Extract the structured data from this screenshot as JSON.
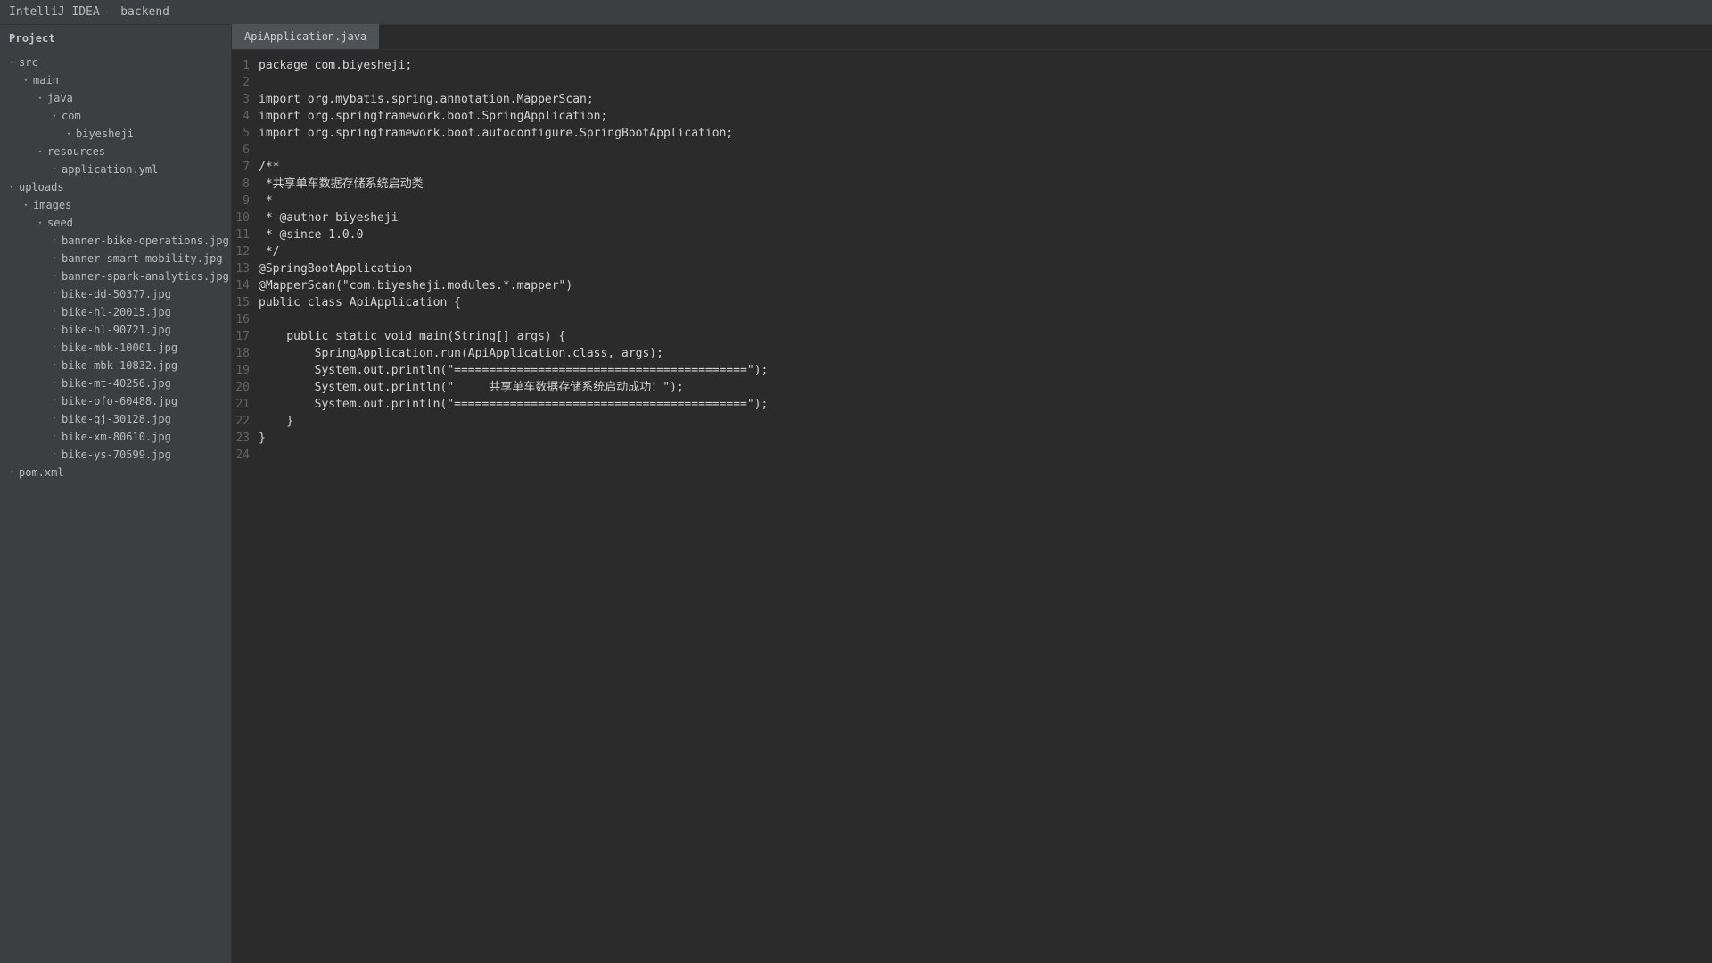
{
  "window": {
    "title": "IntelliJ IDEA — backend"
  },
  "sidebar": {
    "header": "Project",
    "items": [
      {
        "label": "src",
        "depth": 0,
        "type": "folder",
        "expanded": true
      },
      {
        "label": "main",
        "depth": 1,
        "type": "folder",
        "expanded": true
      },
      {
        "label": "java",
        "depth": 2,
        "type": "folder",
        "expanded": true
      },
      {
        "label": "com",
        "depth": 3,
        "type": "folder",
        "expanded": true
      },
      {
        "label": "biyesheji",
        "depth": 4,
        "type": "folder",
        "expanded": true
      },
      {
        "label": "resources",
        "depth": 2,
        "type": "folder",
        "expanded": true
      },
      {
        "label": "application.yml",
        "depth": 3,
        "type": "file"
      },
      {
        "label": "uploads",
        "depth": 0,
        "type": "folder",
        "expanded": true
      },
      {
        "label": "images",
        "depth": 1,
        "type": "folder",
        "expanded": true
      },
      {
        "label": "seed",
        "depth": 2,
        "type": "folder",
        "expanded": true
      },
      {
        "label": "banner-bike-operations.jpg",
        "depth": 3,
        "type": "file"
      },
      {
        "label": "banner-smart-mobility.jpg",
        "depth": 3,
        "type": "file"
      },
      {
        "label": "banner-spark-analytics.jpg",
        "depth": 3,
        "type": "file"
      },
      {
        "label": "bike-dd-50377.jpg",
        "depth": 3,
        "type": "file"
      },
      {
        "label": "bike-hl-20015.jpg",
        "depth": 3,
        "type": "file"
      },
      {
        "label": "bike-hl-90721.jpg",
        "depth": 3,
        "type": "file"
      },
      {
        "label": "bike-mbk-10001.jpg",
        "depth": 3,
        "type": "file"
      },
      {
        "label": "bike-mbk-10832.jpg",
        "depth": 3,
        "type": "file"
      },
      {
        "label": "bike-mt-40256.jpg",
        "depth": 3,
        "type": "file"
      },
      {
        "label": "bike-ofo-60488.jpg",
        "depth": 3,
        "type": "file"
      },
      {
        "label": "bike-qj-30128.jpg",
        "depth": 3,
        "type": "file"
      },
      {
        "label": "bike-xm-80610.jpg",
        "depth": 3,
        "type": "file"
      },
      {
        "label": "bike-ys-70599.jpg",
        "depth": 3,
        "type": "file"
      },
      {
        "label": "pom.xml",
        "depth": 0,
        "type": "file"
      }
    ]
  },
  "editor": {
    "tabs": [
      {
        "label": "ApiApplication.java",
        "active": true
      }
    ],
    "lines": [
      {
        "no": "1",
        "text": "package com.biyesheji;"
      },
      {
        "no": "2",
        "text": ""
      },
      {
        "no": "3",
        "text": "import org.mybatis.spring.annotation.MapperScan;"
      },
      {
        "no": "4",
        "text": "import org.springframework.boot.SpringApplication;"
      },
      {
        "no": "5",
        "text": "import org.springframework.boot.autoconfigure.SpringBootApplication;"
      },
      {
        "no": "6",
        "text": ""
      },
      {
        "no": "7",
        "text": "/**"
      },
      {
        "no": "8",
        "text": " *共享单车数据存储系统启动类"
      },
      {
        "no": "9",
        "text": " *"
      },
      {
        "no": "10",
        "text": " * @author biyesheji"
      },
      {
        "no": "11",
        "text": " * @since 1.0.0"
      },
      {
        "no": "12",
        "text": " */"
      },
      {
        "no": "13",
        "text": "@SpringBootApplication"
      },
      {
        "no": "14",
        "text": "@MapperScan(\"com.biyesheji.modules.*.mapper\")"
      },
      {
        "no": "15",
        "text": "public class ApiApplication {"
      },
      {
        "no": "16",
        "text": ""
      },
      {
        "no": "17",
        "text": "    public static void main(String[] args) {"
      },
      {
        "no": "18",
        "text": "        SpringApplication.run(ApiApplication.class, args);"
      },
      {
        "no": "19",
        "text": "        System.out.println(\"==========================================\");"
      },
      {
        "no": "20",
        "text": "        System.out.println(\"     共享单车数据存储系统启动成功！\");"
      },
      {
        "no": "21",
        "text": "        System.out.println(\"==========================================\");"
      },
      {
        "no": "22",
        "text": "    }"
      },
      {
        "no": "23",
        "text": "}"
      },
      {
        "no": "24",
        "text": ""
      }
    ]
  },
  "icons": {
    "folder_toggle": "▾",
    "file_bullet": "•"
  },
  "colors": {
    "background": "#2b2b2b",
    "sidebar": "#3c3f41",
    "tab_active": "#4e5254",
    "text": "#a9b7c6",
    "line_numbers": "#606366"
  }
}
